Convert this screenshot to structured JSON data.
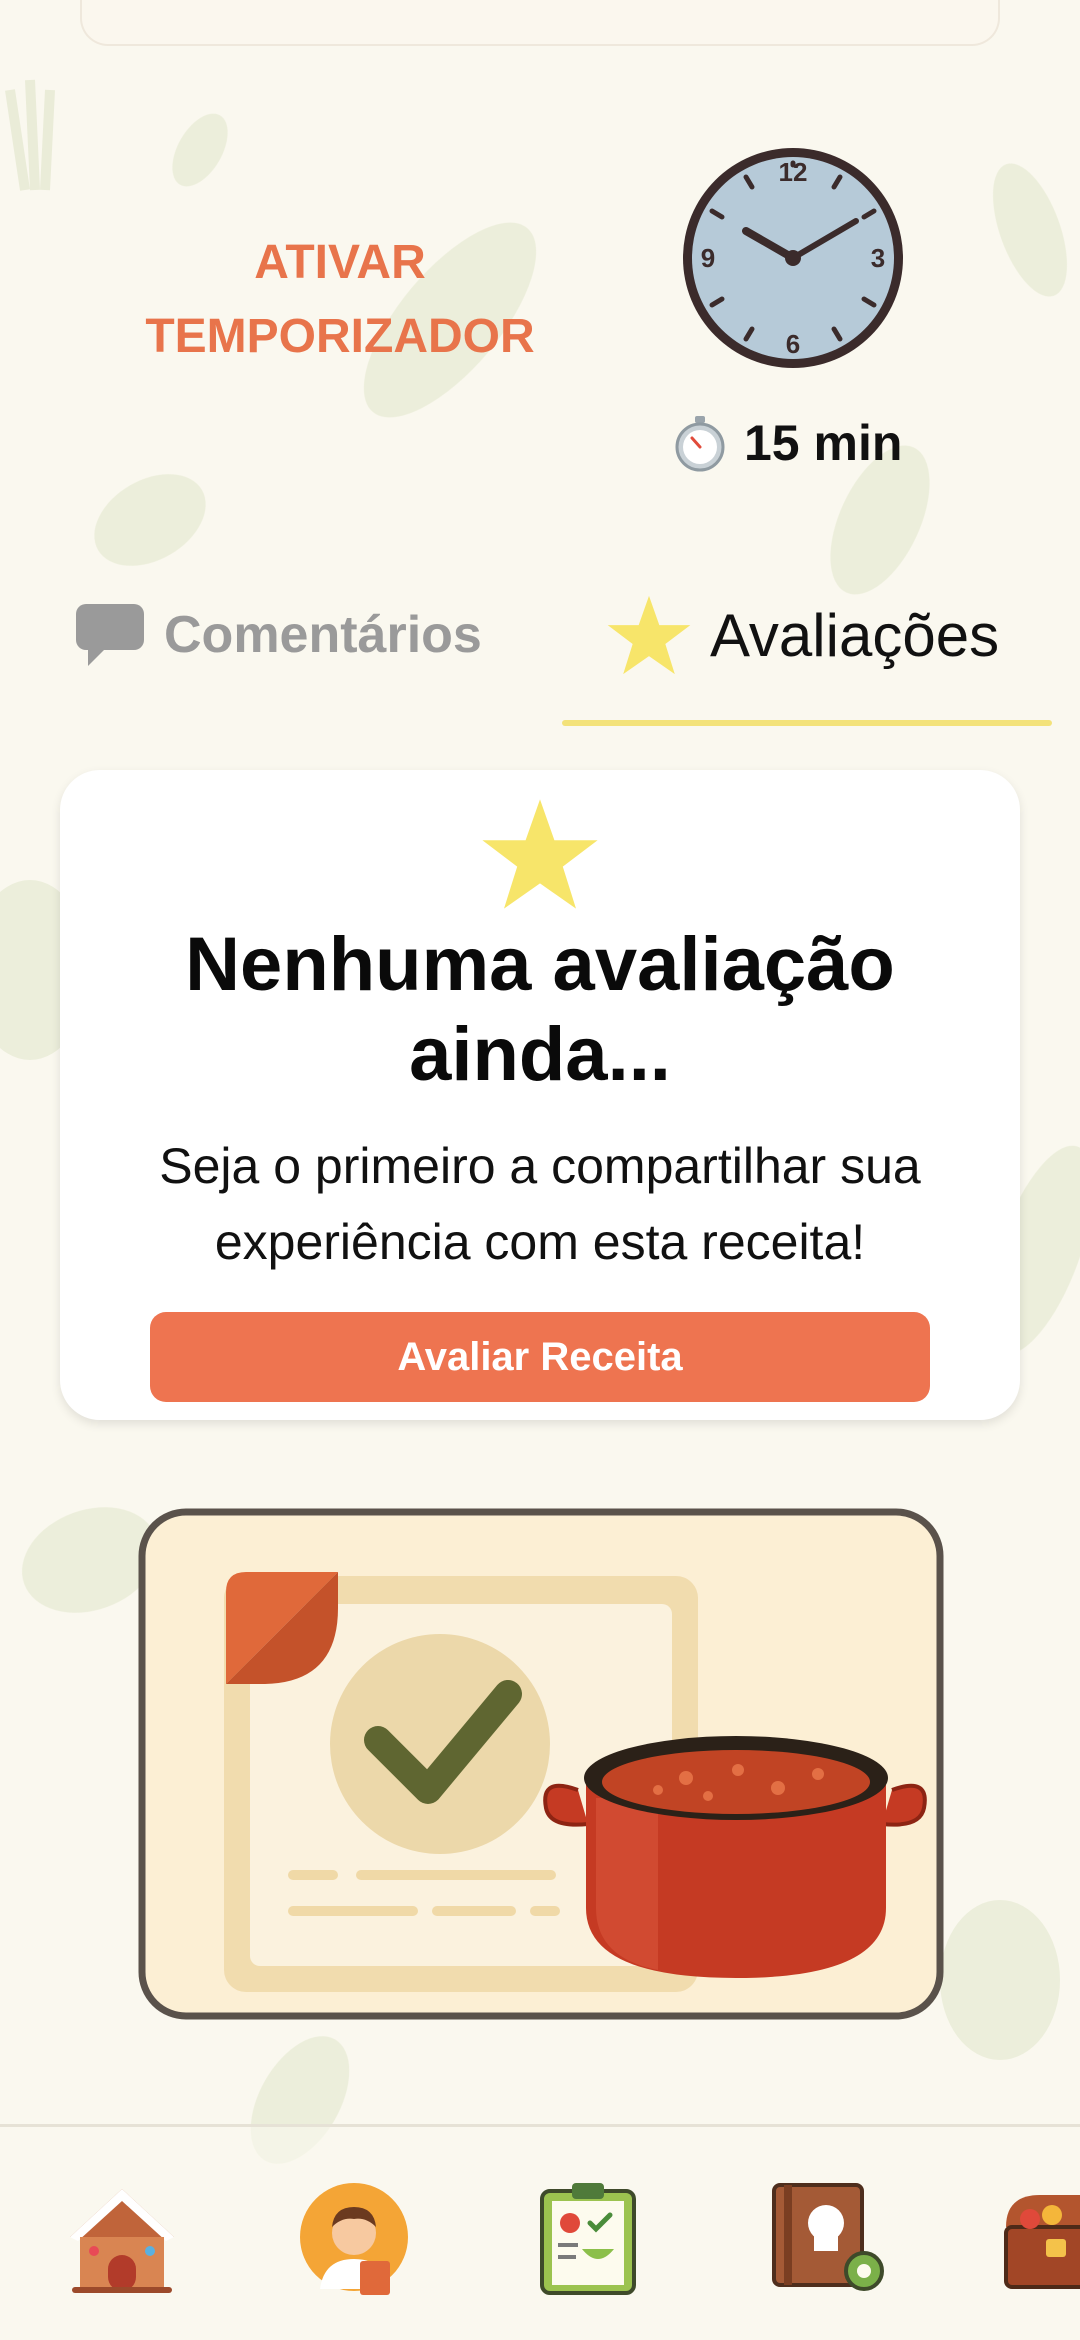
{
  "timer": {
    "button_line1": "ATIVAR",
    "button_line2": "TEMPORIZADOR",
    "clock_numbers": [
      "12",
      "3",
      "6",
      "9"
    ],
    "duration": "15 min"
  },
  "tabs": [
    {
      "label": "Comentários",
      "icon": "speech-bubble-icon",
      "active": false
    },
    {
      "label": "Avaliações",
      "icon": "star-icon",
      "active": true
    }
  ],
  "empty_state": {
    "title_line1": "Nenhuma avaliação",
    "title_line2": "ainda...",
    "subtitle_line1": "Seja o primeiro a compartilhar sua",
    "subtitle_line2": "experiência com esta receita!",
    "button_label": "Avaliar Receita"
  },
  "bottom_nav": [
    {
      "icon": "gingerbread-house-icon"
    },
    {
      "icon": "chef-profile-icon"
    },
    {
      "icon": "shopping-list-clipboard-icon"
    },
    {
      "icon": "recipe-book-settings-icon"
    },
    {
      "icon": "treasure-chest-icon"
    }
  ],
  "colors": {
    "background": "#faf8ef",
    "accent_orange": "#ee7450",
    "timer_text": "#e8744b",
    "star_yellow": "#f7e56a",
    "tab_underline": "#f3e27a",
    "inactive_tab": "#9a9a9a"
  }
}
